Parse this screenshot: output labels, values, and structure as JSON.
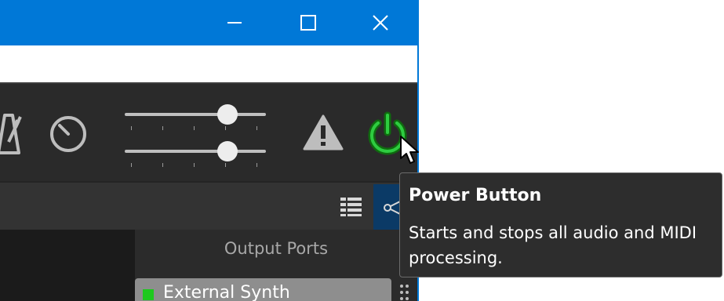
{
  "titlebar": {
    "color": "#0078d7",
    "buttons": [
      {
        "icon": "minimize-icon"
      },
      {
        "icon": "maximize-icon"
      },
      {
        "icon": "close-icon"
      }
    ]
  },
  "toolbar": {
    "icons": [
      "metronome-icon",
      "tempo-dial-icon",
      "warning-icon",
      "power-icon"
    ],
    "sliders": [
      {
        "name": "top-slider",
        "level_percent": 73
      },
      {
        "name": "bottom-slider",
        "level_percent": 73
      }
    ],
    "power_state_color": "#2ecc40"
  },
  "viewbar": {
    "icons": [
      "list-view-icon",
      "graph-view-icon"
    ],
    "active_view": "graph-view-icon",
    "active_color": "#0b3a66"
  },
  "ports_panel": {
    "heading": "Output Ports",
    "items": [
      {
        "label": "External Synth",
        "status_color": "#1ec81e"
      }
    ]
  },
  "tooltip": {
    "title": "Power Button",
    "body": "Starts and stops all audio and MIDI processing."
  }
}
